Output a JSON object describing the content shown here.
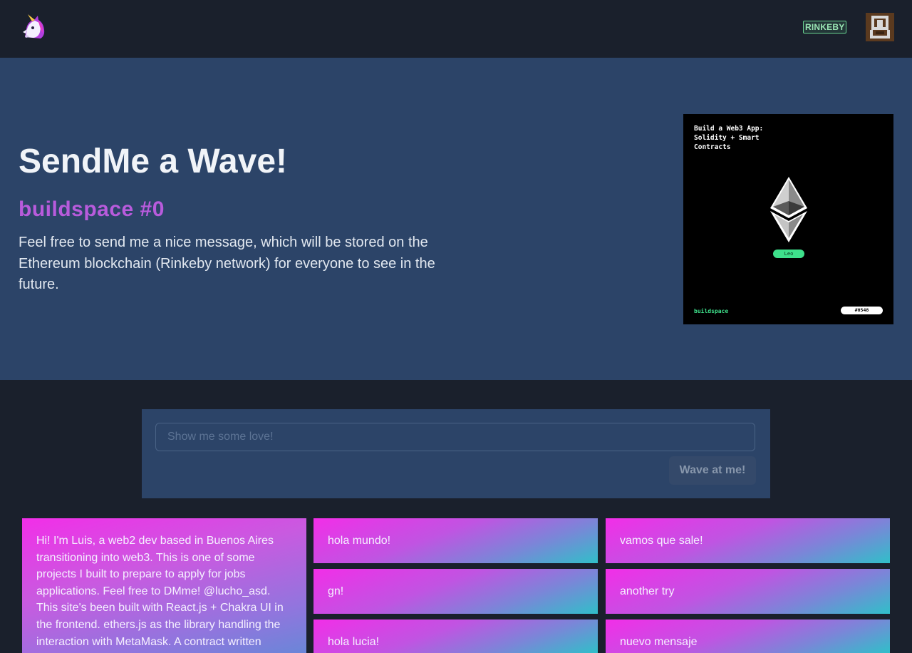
{
  "header": {
    "logo_icon": "unicorn-icon",
    "network_badge": "RINKEBY",
    "avatar_icon": "pixel-avatar-icon"
  },
  "hero": {
    "title": "SendMe a Wave!",
    "subtitle": "buildspace #0",
    "description": "Feel free to send me a nice message, which will be stored on the Ethereum blockchain (Rinkeby network) for everyone to see in the future.",
    "nft": {
      "title": "Build a Web3 App: Solidity + Smart Contracts",
      "icon": "ethereum-icon",
      "name_tag": "Leo",
      "brand": "buildspace",
      "number": "#0548"
    }
  },
  "form": {
    "placeholder": "Show me some love!",
    "value": "",
    "button_label": "Wave at me!"
  },
  "messages": [
    "Hi! I'm Luis, a web2 dev based in Buenos Aires transitioning into web3. This is one of some projects I built to prepare to apply for jobs applications. Feel free to DMme! @lucho_asd. This site's been built with React.js + Chakra UI in the frontend. ethers.js as the library handling the interaction with MetaMask. A contract written",
    "hola mundo!",
    "vamos que sale!",
    "gn!",
    "another try",
    "hola lucia!",
    "nuevo mensaje"
  ],
  "colors": {
    "background": "#1a202c",
    "hero_bg": "#2c4468",
    "accent_purple": "#b85bdc",
    "badge_green": "#68d391",
    "gradient_pink": "#f22ee8",
    "gradient_teal": "#30bfc9"
  }
}
